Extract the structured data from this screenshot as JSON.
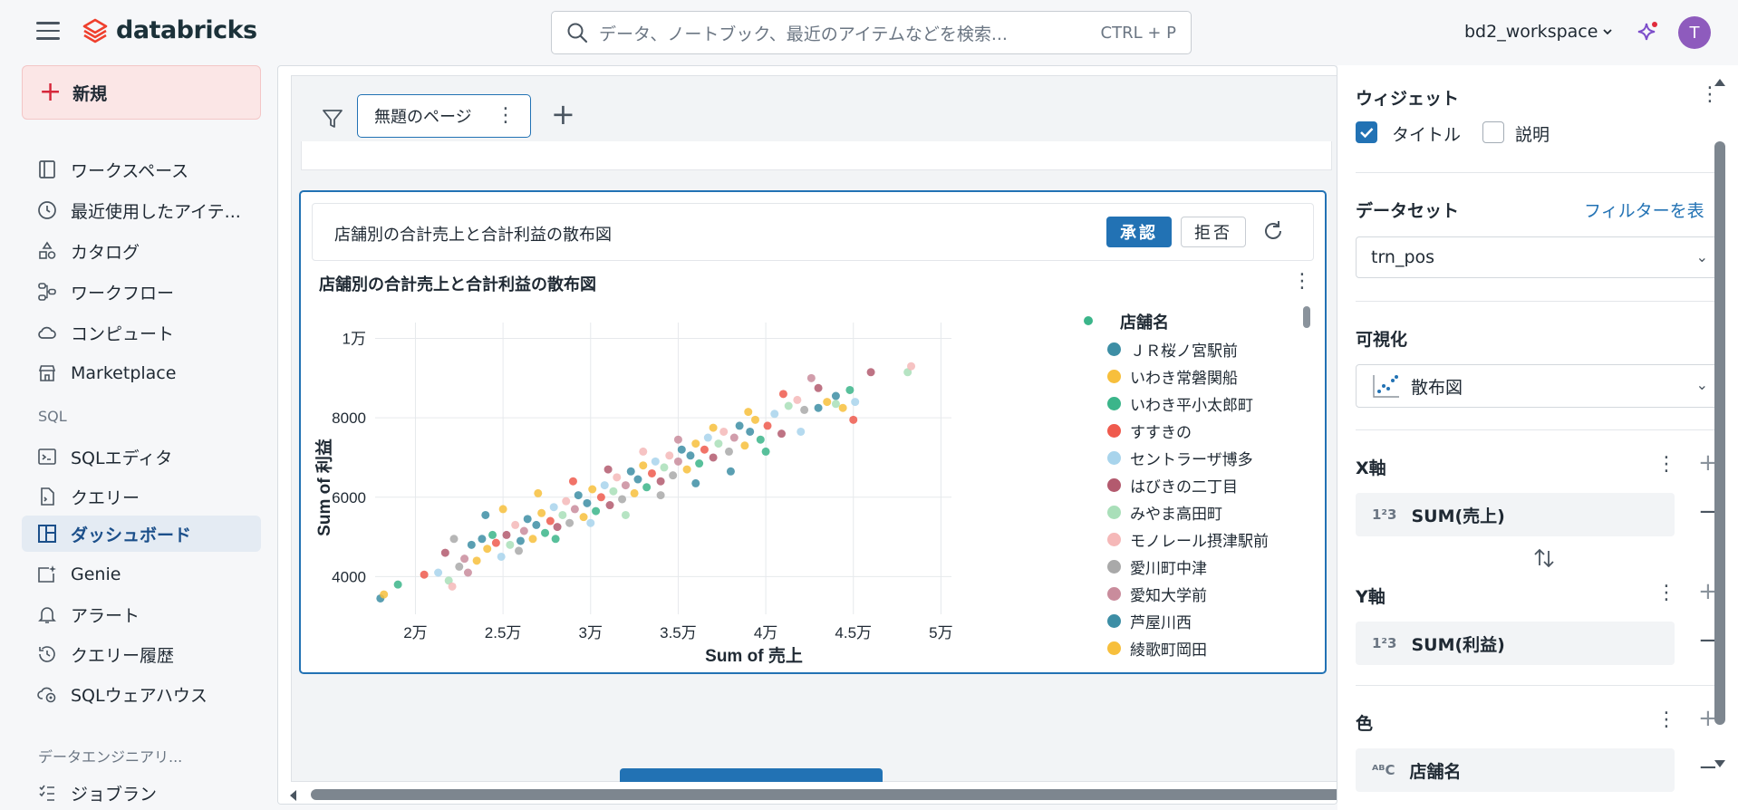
{
  "app": {
    "logo_text": "databricks",
    "search_placeholder": "データ、ノートブック、最近のアイテムなどを検索...",
    "search_shortcut": "CTRL + P",
    "workspace": "bd2_workspace",
    "avatar_initial": "T"
  },
  "sidebar": {
    "new_label": "新規",
    "items": [
      {
        "label": "ワークスペース",
        "icon": "workspace-icon"
      },
      {
        "label": "最近使用したアイテ...",
        "icon": "clock-icon"
      },
      {
        "label": "カタログ",
        "icon": "catalog-icon"
      },
      {
        "label": "ワークフロー",
        "icon": "workflow-icon"
      },
      {
        "label": "コンピュート",
        "icon": "cloud-icon"
      },
      {
        "label": "Marketplace",
        "icon": "store-icon"
      }
    ],
    "sql_section": "SQL",
    "sql_items": [
      {
        "label": "SQLエディタ",
        "icon": "sql-editor-icon"
      },
      {
        "label": "クエリー",
        "icon": "query-icon"
      },
      {
        "label": "ダッシュボード",
        "icon": "dashboard-icon",
        "active": true
      },
      {
        "label": "Genie",
        "icon": "genie-icon"
      },
      {
        "label": "アラート",
        "icon": "bell-icon"
      },
      {
        "label": "クエリー履歴",
        "icon": "history-icon"
      },
      {
        "label": "SQLウェアハウス",
        "icon": "warehouse-icon"
      }
    ],
    "de_section": "データエンジニアリ...",
    "de_items": [
      {
        "label": "ジョブラン",
        "icon": "job-run-icon"
      }
    ]
  },
  "canvas": {
    "page_tab": "無題のページ",
    "widget": {
      "suggestion_title": "店舗別の合計売上と合計利益の散布図",
      "approve_label": "承認",
      "reject_label": "拒否",
      "chart_title": "店舗別の合計売上と合計利益の散布図"
    }
  },
  "chart_data": {
    "type": "scatter",
    "xlabel": "Sum of 売上",
    "ylabel": "Sum of 利益",
    "x_ticks": [
      "2万",
      "2.5万",
      "3万",
      "3.5万",
      "4万",
      "4.5万",
      "5万"
    ],
    "x_tick_values": [
      20000,
      25000,
      30000,
      35000,
      40000,
      45000,
      50000
    ],
    "y_ticks": [
      "1万",
      "8000",
      "6000",
      "4000"
    ],
    "y_tick_values": [
      10000,
      8000,
      6000,
      4000
    ],
    "xlim": [
      17700,
      50600
    ],
    "ylim": [
      3050,
      10400
    ],
    "grid": true,
    "legend_title": "店舗名",
    "legend_position": "right",
    "series": [
      {
        "name": "ＪＲ桜ノ宮駅前",
        "color": "#3d8ea5"
      },
      {
        "name": "いわき常磐関船",
        "color": "#f7bf3c"
      },
      {
        "name": "いわき平小太郎町",
        "color": "#3bb58a"
      },
      {
        "name": "すすきの",
        "color": "#ef5a4d"
      },
      {
        "name": "セントラーザ博多",
        "color": "#a8d4ec"
      },
      {
        "name": "はびきの二丁目",
        "color": "#b35a6e"
      },
      {
        "name": "みやま高田町",
        "color": "#a9dfb9"
      },
      {
        "name": "モノレール摂津駅前",
        "color": "#f5b8b8"
      },
      {
        "name": "愛川町中津",
        "color": "#a9a9a9"
      },
      {
        "name": "愛知大学前",
        "color": "#c98c9c"
      },
      {
        "name": "芦屋川西",
        "color": "#3d8ea5"
      },
      {
        "name": "綾歌町岡田",
        "color": "#f7bf3c"
      }
    ],
    "points_note_free": true,
    "points": [
      [
        18000,
        3450
      ],
      [
        18200,
        3550
      ],
      [
        19000,
        3800
      ],
      [
        20500,
        4050
      ],
      [
        21300,
        4100
      ],
      [
        21700,
        4600
      ],
      [
        21900,
        3900
      ],
      [
        22100,
        3750
      ],
      [
        22500,
        4250
      ],
      [
        22800,
        4450
      ],
      [
        23200,
        4800
      ],
      [
        23500,
        4400
      ],
      [
        23800,
        4950
      ],
      [
        24100,
        4700
      ],
      [
        24400,
        5050
      ],
      [
        24600,
        4850
      ],
      [
        24900,
        4500
      ],
      [
        25200,
        5050
      ],
      [
        25400,
        4800
      ],
      [
        25700,
        5300
      ],
      [
        25900,
        4650
      ],
      [
        26200,
        5150
      ],
      [
        26400,
        5450
      ],
      [
        26700,
        4950
      ],
      [
        26900,
        5300
      ],
      [
        27200,
        5600
      ],
      [
        27400,
        5100
      ],
      [
        27700,
        5400
      ],
      [
        27900,
        5750
      ],
      [
        28100,
        5250
      ],
      [
        28400,
        5550
      ],
      [
        28600,
        5900
      ],
      [
        28800,
        5350
      ],
      [
        29100,
        5700
      ],
      [
        29300,
        6050
      ],
      [
        29600,
        5500
      ],
      [
        29800,
        5850
      ],
      [
        30100,
        6200
      ],
      [
        30300,
        5650
      ],
      [
        30600,
        6000
      ],
      [
        30800,
        6300
      ],
      [
        31100,
        5800
      ],
      [
        31300,
        6150
      ],
      [
        31500,
        6500
      ],
      [
        31800,
        5950
      ],
      [
        32000,
        6300
      ],
      [
        32300,
        6650
      ],
      [
        32500,
        6100
      ],
      [
        32700,
        6450
      ],
      [
        33000,
        6800
      ],
      [
        33200,
        6250
      ],
      [
        33500,
        6600
      ],
      [
        33700,
        6900
      ],
      [
        34000,
        6400
      ],
      [
        34200,
        6750
      ],
      [
        34500,
        7050
      ],
      [
        34700,
        6550
      ],
      [
        35000,
        6900
      ],
      [
        35200,
        7200
      ],
      [
        35500,
        6700
      ],
      [
        35700,
        7050
      ],
      [
        36000,
        7350
      ],
      [
        36200,
        6850
      ],
      [
        36500,
        7200
      ],
      [
        36700,
        7500
      ],
      [
        37000,
        7000
      ],
      [
        37300,
        7350
      ],
      [
        37600,
        7650
      ],
      [
        37900,
        7150
      ],
      [
        38200,
        7500
      ],
      [
        38500,
        7800
      ],
      [
        38800,
        7300
      ],
      [
        39100,
        7650
      ],
      [
        39400,
        7950
      ],
      [
        39700,
        7450
      ],
      [
        40100,
        7800
      ],
      [
        40500,
        8100
      ],
      [
        40900,
        7600
      ],
      [
        41300,
        8300
      ],
      [
        41800,
        8450
      ],
      [
        42200,
        8200
      ],
      [
        42600,
        9000
      ],
      [
        43000,
        8250
      ],
      [
        43500,
        8400
      ],
      [
        44000,
        8550
      ],
      [
        44400,
        8250
      ],
      [
        44800,
        8700
      ],
      [
        45000,
        7950
      ],
      [
        45100,
        8400
      ],
      [
        46000,
        9150
      ],
      [
        48100,
        9150
      ],
      [
        48300,
        9300
      ],
      [
        22200,
        4950
      ],
      [
        23000,
        4100
      ],
      [
        24000,
        5550
      ],
      [
        25000,
        5700
      ],
      [
        26000,
        4900
      ],
      [
        27000,
        6100
      ],
      [
        28000,
        4950
      ],
      [
        29000,
        6400
      ],
      [
        30000,
        5350
      ],
      [
        31000,
        6700
      ],
      [
        32000,
        5550
      ],
      [
        33000,
        7150
      ],
      [
        34000,
        6050
      ],
      [
        35000,
        7450
      ],
      [
        36000,
        6350
      ],
      [
        37000,
        7750
      ],
      [
        38000,
        6650
      ],
      [
        39000,
        8150
      ],
      [
        40000,
        7150
      ],
      [
        41000,
        8600
      ],
      [
        42000,
        7650
      ],
      [
        43000,
        8750
      ],
      [
        44000,
        8350
      ]
    ]
  },
  "panel": {
    "widget_heading": "ウィジェット",
    "title_label": "タイトル",
    "title_checked": true,
    "description_label": "説明",
    "description_checked": false,
    "dataset_heading": "データセット",
    "filter_link": "フィルターを表",
    "dataset_value": "trn_pos",
    "viz_heading": "可視化",
    "viz_value": "散布図",
    "x_heading": "X軸",
    "x_field": "SUM(売上)",
    "y_heading": "Y軸",
    "y_field": "SUM(利益)",
    "color_heading": "色",
    "color_field": "店舗名",
    "num_type": "1²3",
    "text_type": "ᴬᴮC"
  }
}
